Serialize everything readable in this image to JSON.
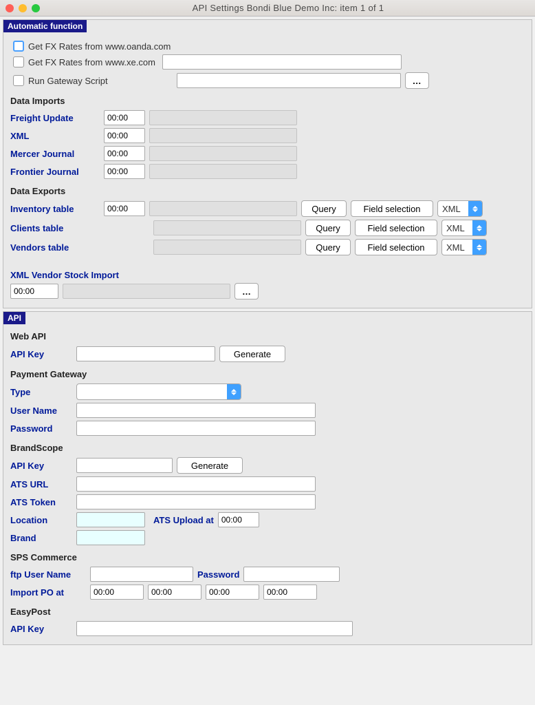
{
  "titlebar": {
    "title": "API Settings    Bondi Blue Demo Inc: item 1  of  1"
  },
  "automatic_function": {
    "header": "Automatic function",
    "checks": {
      "oanda": "Get FX Rates from www.oanda.com",
      "xe": "Get FX Rates from www.xe.com",
      "gateway": "Run Gateway Script"
    },
    "ellipsis": "…",
    "data_imports": {
      "title": "Data Imports",
      "freight": {
        "label": "Freight Update",
        "time": "00:00"
      },
      "xml": {
        "label": "XML",
        "time": "00:00"
      },
      "mercer": {
        "label": "Mercer Journal",
        "time": "00:00"
      },
      "frontier": {
        "label": "Frontier Journal",
        "time": "00:00"
      }
    },
    "data_exports": {
      "title": "Data Exports",
      "inventory": {
        "label": "Inventory table",
        "time": "00:00"
      },
      "clients": {
        "label": "Clients table"
      },
      "vendors": {
        "label": "Vendors table"
      },
      "query_label": "Query",
      "field_selection_label": "Field selection",
      "xml_label": "XML"
    },
    "xml_vendor": {
      "label": "XML Vendor Stock Import",
      "time": "00:00",
      "ellipsis": "…"
    }
  },
  "api": {
    "header": "API",
    "web_api": {
      "title": "Web API",
      "api_key_label": "API Key",
      "generate": "Generate"
    },
    "payment": {
      "title": "Payment Gateway",
      "type": "Type",
      "user": "User Name",
      "password": "Password"
    },
    "brandscope": {
      "title": "BrandScope",
      "api_key": "API Key",
      "generate": "Generate",
      "ats_url": "ATS URL",
      "ats_token": "ATS Token",
      "location": "Location",
      "ats_upload": "ATS Upload at",
      "ats_time": "00:00",
      "brand": "Brand"
    },
    "sps": {
      "title": "SPS Commerce",
      "ftp_user": "ftp User Name",
      "password": "Password",
      "import_po": "Import PO at",
      "t1": "00:00",
      "t2": "00:00",
      "t3": "00:00",
      "t4": "00:00"
    },
    "easypost": {
      "title": "EasyPost",
      "api_key": "API Key"
    }
  }
}
